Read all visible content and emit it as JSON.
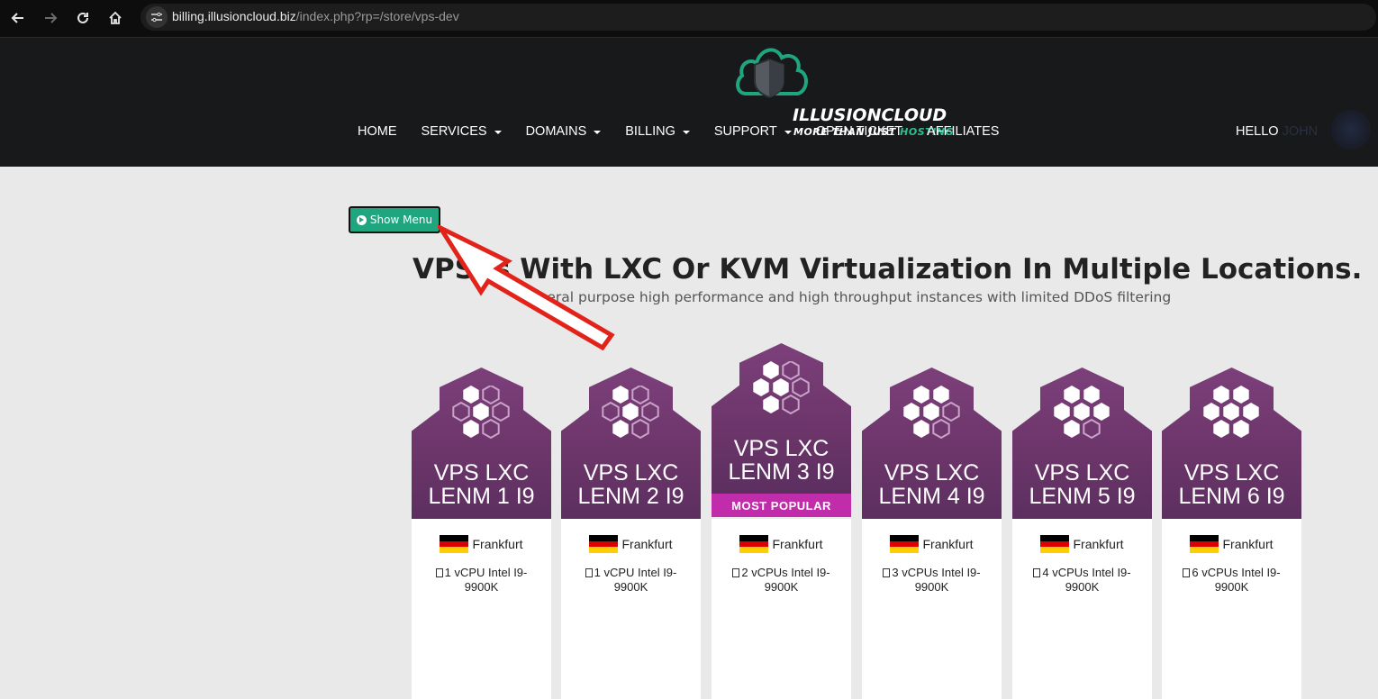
{
  "browser": {
    "url_host": "billing.illusioncloud.biz",
    "url_path": "/index.php?rp=/store/vps-dev"
  },
  "brand": {
    "name": "ILLUSIONCLOUD",
    "tagline_part1": "MORE THAN JUST",
    "tagline_part2": "HOSTING",
    "accent_color": "#2bbf8f"
  },
  "nav": {
    "items": [
      {
        "label": "HOME",
        "dropdown": false
      },
      {
        "label": "SERVICES",
        "dropdown": true
      },
      {
        "label": "DOMAINS",
        "dropdown": true
      },
      {
        "label": "BILLING",
        "dropdown": true
      },
      {
        "label": "SUPPORT",
        "dropdown": true
      },
      {
        "label": "OPEN TICKET",
        "dropdown": false
      },
      {
        "label": "AFFILIATES",
        "dropdown": false
      }
    ],
    "hello_label": "HELLO",
    "hello_name": "JOHN"
  },
  "content": {
    "show_menu_label": "Show Menu",
    "title": "VPSes With LXC Or KVM Virtualization In Multiple Locations.",
    "subtitle": "General purpose high performance and high throughput instances with limited DDoS filtering"
  },
  "products": [
    {
      "line1": "VPS LXC",
      "line2": "LENM 1 I9",
      "popular": false,
      "location": "Frankfurt",
      "cpu1": "1 vCPU Intel I9-",
      "cpu2": "9900K"
    },
    {
      "line1": "VPS LXC",
      "line2": "LENM 2 I9",
      "popular": false,
      "location": "Frankfurt",
      "cpu1": "1 vCPU Intel I9-",
      "cpu2": "9900K"
    },
    {
      "line1": "VPS LXC",
      "line2": "LENM 3 I9",
      "popular": true,
      "popular_label": "MOST POPULAR",
      "location": "Frankfurt",
      "cpu1": "2 vCPUs Intel I9-",
      "cpu2": "9900K"
    },
    {
      "line1": "VPS LXC",
      "line2": "LENM 4 I9",
      "popular": false,
      "location": "Frankfurt",
      "cpu1": "3 vCPUs Intel I9-",
      "cpu2": "9900K"
    },
    {
      "line1": "VPS LXC",
      "line2": "LENM 5 I9",
      "popular": false,
      "location": "Frankfurt",
      "cpu1": "4 vCPUs Intel I9-",
      "cpu2": "9900K"
    },
    {
      "line1": "VPS LXC",
      "line2": "LENM 6 I9",
      "popular": false,
      "location": "Frankfurt",
      "cpu1": "6 vCPUs Intel I9-",
      "cpu2": "9900K"
    }
  ]
}
